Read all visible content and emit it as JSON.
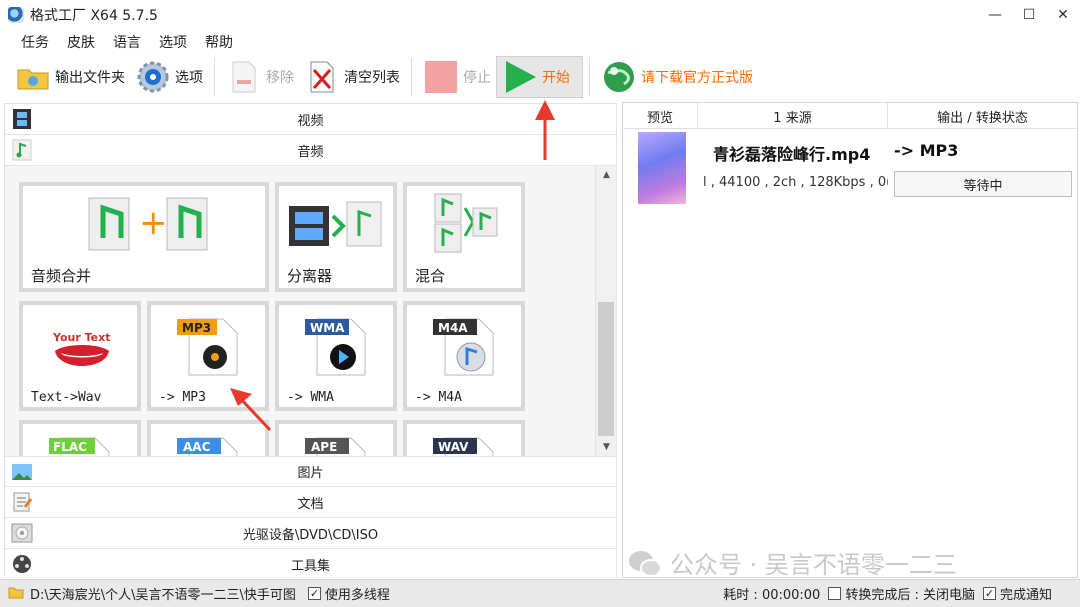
{
  "window": {
    "title": "格式工厂 X64 5.7.5",
    "minimize": "—",
    "maximize": "☐",
    "close": "✕"
  },
  "menu": [
    "任务",
    "皮肤",
    "语言",
    "选项",
    "帮助"
  ],
  "toolbar": {
    "output_folder": "输出文件夹",
    "options": "选项",
    "remove": "移除",
    "clear_list": "清空列表",
    "stop": "停止",
    "start": "开始",
    "download": "请下载官方正式版"
  },
  "categories": {
    "video": "视频",
    "audio": "音频",
    "image": "图片",
    "document": "文档",
    "optical": "光驱设备\\DVD\\CD\\ISO",
    "tools": "工具集"
  },
  "tiles": [
    {
      "label": "音频合并",
      "icon": "audio-merge-icon"
    },
    {
      "label": "分离器",
      "icon": "splitter-icon"
    },
    {
      "label": "混合",
      "icon": "mix-icon"
    },
    {
      "label": "Text->Wav",
      "icon": "text-to-speech-icon"
    },
    {
      "label": "-> MP3",
      "icon": "mp3-icon",
      "badge": "MP3"
    },
    {
      "label": "-> WMA",
      "icon": "wma-icon",
      "badge": "WMA"
    },
    {
      "label": "-> M4A",
      "icon": "m4a-icon",
      "badge": "M4A"
    },
    {
      "label": "",
      "icon": "flac-icon",
      "badge": "FLAC"
    },
    {
      "label": "",
      "icon": "aac-icon",
      "badge": "AAC"
    },
    {
      "label": "",
      "icon": "ape-icon",
      "badge": "APE"
    },
    {
      "label": "",
      "icon": "wav-icon",
      "badge": "WAV"
    }
  ],
  "tile_art_text": {
    "your_text": "Your Text"
  },
  "task_list": {
    "headers": [
      "预览",
      "1 来源",
      "输出 / 转换状态"
    ],
    "rows": [
      {
        "source": "青衫磊落险峰行.mp4",
        "output": "-> MP3",
        "info": "l , 44100 , 2ch , 128Kbps , 0(",
        "status": "等待中"
      }
    ]
  },
  "watermark": "公众号 · 吴言不语零一二三",
  "statusbar": {
    "path": "D:\\天海宸光\\个人\\吴言不语零一二三\\快手可图",
    "multithread": "使用多线程",
    "multithread_checked": true,
    "elapsed": "耗时 : 00:00:00",
    "after_done": "转换完成后 : 关闭电脑",
    "after_done_checked": false,
    "notify": "完成通知",
    "notify_checked": true
  },
  "colors": {
    "accent_orange": "#ff6a00",
    "start_green": "#22b14c",
    "annotation_red": "#e8392f"
  }
}
